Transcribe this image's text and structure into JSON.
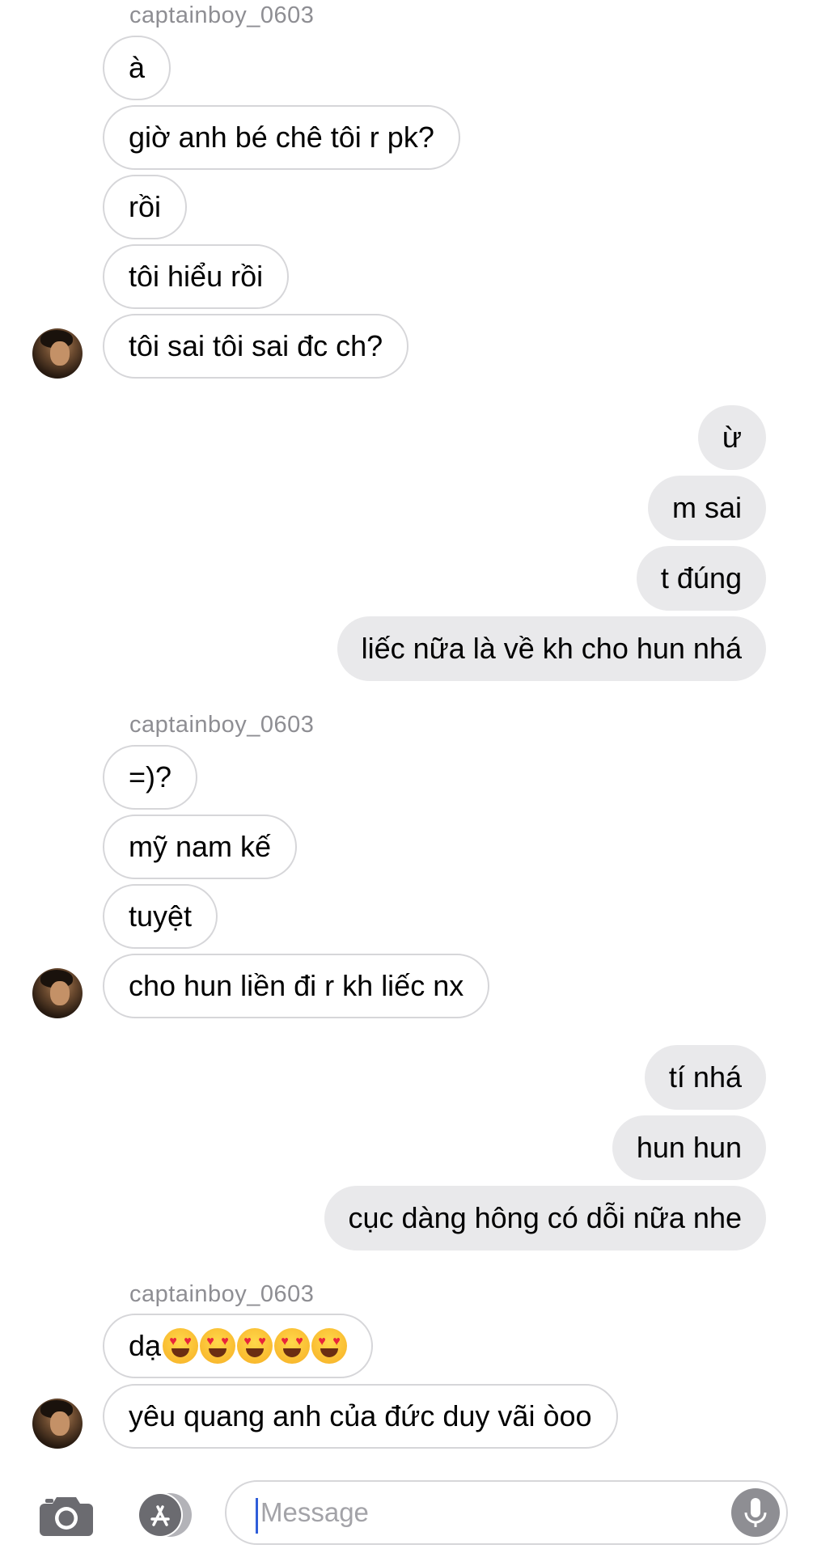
{
  "conversation": {
    "groups": [
      {
        "sender": "captainboy_0603",
        "direction": "in",
        "messages": [
          "à",
          "giờ anh bé chê tôi r pk?",
          "rồi",
          "tôi hiểu rồi",
          "tôi sai tôi sai đc ch?"
        ]
      },
      {
        "direction": "out",
        "messages": [
          "ừ",
          "m sai",
          "t đúng",
          "liếc nữa là về kh cho hun nhá"
        ]
      },
      {
        "sender": "captainboy_0603",
        "direction": "in",
        "messages": [
          "=)?",
          "mỹ nam kế",
          "tuyệt",
          "cho hun liền đi r kh liếc nx"
        ]
      },
      {
        "direction": "out",
        "messages": [
          "tí nhá",
          "hun hun",
          "cục dàng hông có dỗi nữa nhe"
        ]
      },
      {
        "sender": "captainboy_0603",
        "direction": "in",
        "messages": [
          "dạ",
          "yêu quang anh của đức duy vãi òoo"
        ],
        "emoji": {
          "name": "heart-eyes-emoji",
          "count": 5
        }
      }
    ]
  },
  "composer": {
    "placeholder": "Message",
    "icons": {
      "camera": "camera-icon",
      "apps": "app-store-icon",
      "mic": "microphone-icon"
    }
  }
}
